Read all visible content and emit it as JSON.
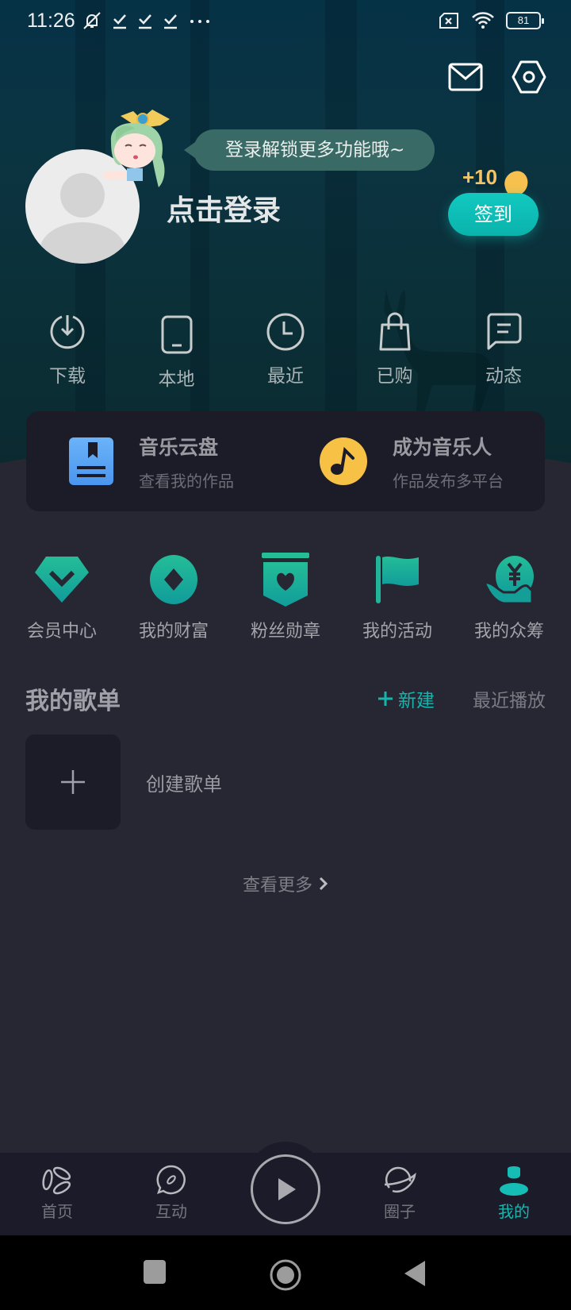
{
  "status_bar": {
    "time": "11:26",
    "battery": "81",
    "left_icons": [
      "mute-icon",
      "check-download-icon",
      "check-download-icon",
      "check-download-icon",
      "more-dots-icon"
    ],
    "right_icons": [
      "no-sim-icon",
      "wifi-icon",
      "battery-icon"
    ]
  },
  "header": {
    "mail_icon": "mail-icon",
    "settings_icon": "settings-icon",
    "bubble_text": "登录解锁更多功能哦~",
    "login_title": "点击登录",
    "coin_reward": "+10",
    "signin_label": "签到"
  },
  "quick_actions": [
    {
      "label": "下载",
      "icon": "download-icon"
    },
    {
      "label": "本地",
      "icon": "phone-icon"
    },
    {
      "label": "最近",
      "icon": "clock-icon"
    },
    {
      "label": "已购",
      "icon": "shopping-bag-icon"
    },
    {
      "label": "动态",
      "icon": "message-icon"
    }
  ],
  "cards": [
    {
      "title": "音乐云盘",
      "subtitle": "查看我的作品",
      "icon": "cloud-drive-icon",
      "color": "#5aa3f5"
    },
    {
      "title": "成为音乐人",
      "subtitle": "作品发布多平台",
      "icon": "music-note-icon",
      "color": "#f7c145"
    }
  ],
  "features": [
    {
      "label": "会员中心",
      "icon": "vip-diamond-icon"
    },
    {
      "label": "我的财富",
      "icon": "wealth-icon"
    },
    {
      "label": "粉丝勋章",
      "icon": "fan-badge-icon"
    },
    {
      "label": "我的活动",
      "icon": "flag-icon"
    },
    {
      "label": "我的众筹",
      "icon": "crowdfunding-icon"
    }
  ],
  "playlists": {
    "title": "我的歌单",
    "new_label": "新建",
    "recent_label": "最近播放",
    "create_label": "创建歌单",
    "see_more": "查看更多"
  },
  "bottom_nav": [
    {
      "label": "首页",
      "icon": "home-petal-icon",
      "active": false
    },
    {
      "label": "互动",
      "icon": "chat-leaf-icon",
      "active": false
    },
    {
      "label": "圈子",
      "icon": "planet-icon",
      "active": false
    },
    {
      "label": "我的",
      "icon": "user-icon",
      "active": true
    }
  ],
  "colors": {
    "accent": "#12c0b8",
    "coin": "#f1c46a",
    "background": "#272733",
    "card": "#1c1b28"
  }
}
